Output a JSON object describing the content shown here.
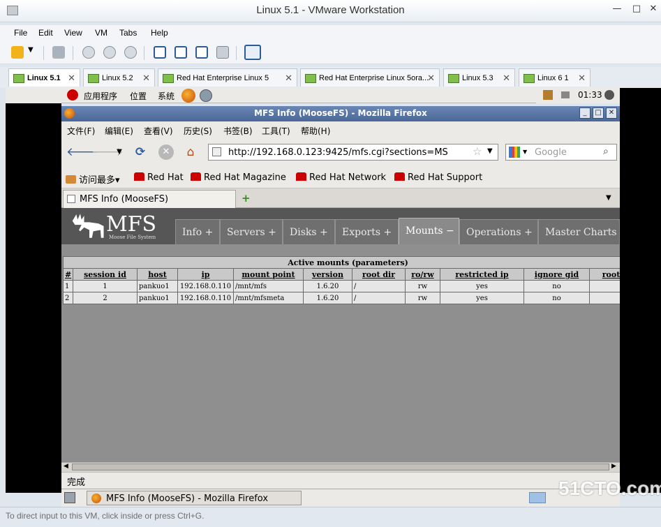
{
  "vmware": {
    "title": "Linux 5.1 - VMware Workstation",
    "menu": [
      "File",
      "Edit",
      "View",
      "VM",
      "Tabs",
      "Help"
    ],
    "tabs": [
      {
        "label": "Linux 5.1",
        "active": true
      },
      {
        "label": "Linux 5.2",
        "active": false
      },
      {
        "label": "Red Hat Enterprise Linux 5",
        "active": false
      },
      {
        "label": "Red Hat Enterprise Linux 5ora...",
        "active": false
      },
      {
        "label": "Linux 5.3",
        "active": false
      },
      {
        "label": "Linux 6 1",
        "active": false
      }
    ],
    "status_hint": "To direct input to this VM, click inside or press Ctrl+G."
  },
  "gnome_panel": {
    "applications": "应用程序",
    "places": "位置",
    "system": "系统",
    "clock": "01:33"
  },
  "firefox": {
    "title": "MFS Info (MooseFS) - Mozilla Firefox",
    "menu": [
      "文件(F)",
      "编辑(E)",
      "查看(V)",
      "历史(S)",
      "书签(B)",
      "工具(T)",
      "帮助(H)"
    ],
    "url": "http://192.168.0.123:9425/mfs.cgi?sections=MS",
    "search_placeholder": "Google",
    "bookmarks": [
      "访问最多▾",
      "Red Hat",
      "Red Hat Magazine",
      "Red Hat Network",
      "Red Hat Support"
    ],
    "tab_label": "MFS Info (MooseFS)",
    "status": "完成",
    "taskbar_item": "MFS Info (MooseFS) - Mozilla Firefox"
  },
  "mfs": {
    "logo": "MFS",
    "logo_sub": "Moose File System",
    "tabs": [
      {
        "label": "Info +",
        "active": false
      },
      {
        "label": "Servers +",
        "active": false
      },
      {
        "label": "Disks +",
        "active": false
      },
      {
        "label": "Exports +",
        "active": false
      },
      {
        "label": "Mounts −",
        "active": true
      },
      {
        "label": "Operations +",
        "active": false
      },
      {
        "label": "Master Charts",
        "active": false
      }
    ],
    "table_caption": "Active mounts (parameters)",
    "columns": [
      "#",
      "session id",
      "host",
      "ip",
      "mount point",
      "version",
      "root dir",
      "ro/rw",
      "restricted ip",
      "ignore gid",
      "root"
    ],
    "rows": [
      [
        "1",
        "1",
        "pankuo1",
        "192.168.0.110",
        "/mnt/mfs",
        "1.6.20",
        "/",
        "rw",
        "yes",
        "no",
        ""
      ],
      [
        "2",
        "2",
        "pankuo1",
        "192.168.0.110",
        "/mnt/mfsmeta",
        "1.6.20",
        "/",
        "rw",
        "yes",
        "no",
        ""
      ]
    ]
  },
  "watermark": "51CTO.com"
}
